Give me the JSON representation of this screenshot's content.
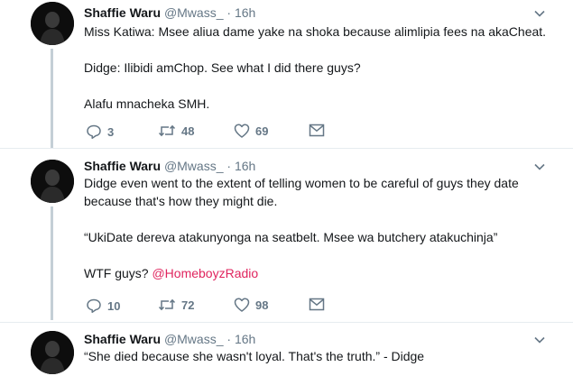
{
  "tweets": [
    {
      "author": "Shaffie Waru",
      "handle": "@Mwass_",
      "time": "16h",
      "paragraphs": [
        "Miss Katiwa: Msee aliua dame yake na shoka because alimlipia fees na akaCheat.",
        "Didge: Ilibidi amChop. See what I did there guys?",
        "Alafu mnacheka SMH."
      ],
      "replies": "3",
      "retweets": "48",
      "likes": "69"
    },
    {
      "author": "Shaffie Waru",
      "handle": "@Mwass_",
      "time": "16h",
      "paragraph1": "Didge even went to the extent of telling women to be careful of guys they date because that's how they might die.",
      "paragraph2": "“UkiDate dereva atakunyonga na seatbelt. Msee wa butchery atakuchinja”",
      "paragraph3_text": "WTF guys? ",
      "paragraph3_mention": "@HomeboyzRadio",
      "replies": "10",
      "retweets": "72",
      "likes": "98"
    },
    {
      "author": "Shaffie Waru",
      "handle": "@Mwass_",
      "time": "16h",
      "paragraphs": [
        "“She died because she wasn't loyal. That's the truth.” - Didge"
      ]
    }
  ],
  "separator": "·",
  "icons": [
    "reply-icon",
    "retweet-icon",
    "like-icon",
    "message-icon",
    "chevron-down-icon"
  ],
  "colors": {
    "mention": "#e0245e",
    "muted": "#657786",
    "thread_line": "#c4cfd6"
  }
}
